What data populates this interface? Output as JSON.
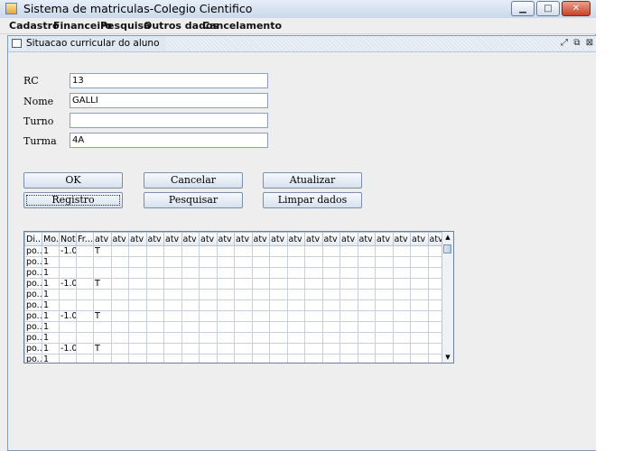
{
  "window": {
    "title": "Sistema de matriculas-Colegio Cientifico"
  },
  "window_controls": {
    "minimize": "▁",
    "maximize": "□",
    "close": "✕"
  },
  "menu": [
    "Cadastro",
    "Financeiro",
    "Pesquisa",
    "Outros dados",
    "Cancelamento"
  ],
  "internal_frame": {
    "title": "Situacao curricular do aluno",
    "controls": [
      "⤢",
      "⧉",
      "⊠"
    ]
  },
  "form": {
    "rc_label": "RC",
    "rc_value": "13",
    "nome_label": "Nome",
    "nome_value": "GALLI",
    "turno_label": "Turno",
    "turno_value": "",
    "turma_label": "Turma",
    "turma_value": "4A"
  },
  "buttons": {
    "ok": "OK",
    "cancelar": "Cancelar",
    "atualizar": "Atualizar",
    "registro": "Registro",
    "pesquisar": "Pesquisar",
    "limpar": "Limpar dados"
  },
  "table": {
    "headers": [
      "Di...",
      "Mo...",
      "Nota",
      "Fr...",
      "atv",
      "atv",
      "atv",
      "atv",
      "atv",
      "atv",
      "atv",
      "atv",
      "atv",
      "atv",
      "atv",
      "atv",
      "atv",
      "atv",
      "atv",
      "atv",
      "atv",
      "atv",
      "atv",
      "atv"
    ],
    "rows": [
      [
        "po...",
        "1",
        "-1.0",
        "",
        "T"
      ],
      [
        "po...",
        "1",
        "",
        "",
        ""
      ],
      [
        "po...",
        "1",
        "",
        "",
        ""
      ],
      [
        "po...",
        "1",
        "-1.0",
        "",
        "T"
      ],
      [
        "po...",
        "1",
        "",
        "",
        ""
      ],
      [
        "po...",
        "1",
        "",
        "",
        ""
      ],
      [
        "po...",
        "1",
        "-1.0",
        "",
        "T"
      ],
      [
        "po...",
        "1",
        "",
        "",
        ""
      ],
      [
        "po...",
        "1",
        "",
        "",
        ""
      ],
      [
        "po...",
        "1",
        "-1.0",
        "",
        "T"
      ],
      [
        "po...",
        "1",
        "",
        "",
        ""
      ],
      [
        "po...",
        "1",
        "",
        "",
        ""
      ]
    ],
    "scroll_up": "▲",
    "scroll_down": "▼"
  }
}
